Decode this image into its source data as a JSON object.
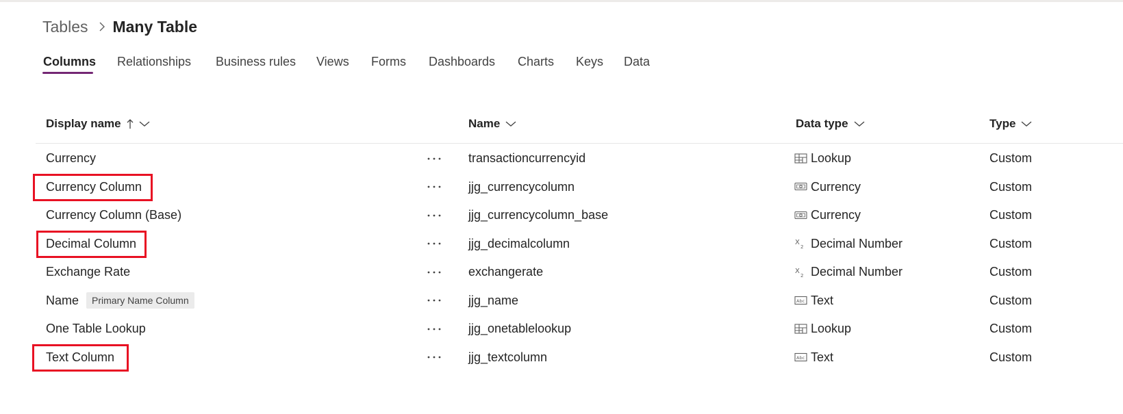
{
  "breadcrumb": {
    "root": "Tables",
    "current": "Many Table"
  },
  "tabs": [
    "Columns",
    "Relationships",
    "Business rules",
    "Views",
    "Forms",
    "Dashboards",
    "Charts",
    "Keys",
    "Data"
  ],
  "active_tab": "Columns",
  "columns": {
    "display_name": "Display name",
    "name": "Name",
    "data_type": "Data type",
    "type": "Type"
  },
  "sort": {
    "column": "Display name",
    "direction": "ascending"
  },
  "rows": [
    {
      "display": "Currency",
      "name": "transactioncurrencyid",
      "data_type": "Lookup",
      "icon": "lookup-icon",
      "type": "Custom"
    },
    {
      "display": "Currency Column",
      "name": "jjg_currencycolumn",
      "data_type": "Currency",
      "icon": "currency-icon",
      "type": "Custom",
      "highlighted": true
    },
    {
      "display": "Currency Column (Base)",
      "name": "jjg_currencycolumn_base",
      "data_type": "Currency",
      "icon": "currency-icon",
      "type": "Custom"
    },
    {
      "display": "Decimal Column",
      "name": "jjg_decimalcolumn",
      "data_type": "Decimal Number",
      "icon": "decimal-icon",
      "type": "Custom",
      "highlighted": true
    },
    {
      "display": "Exchange Rate",
      "name": "exchangerate",
      "data_type": "Decimal Number",
      "icon": "decimal-icon",
      "type": "Custom"
    },
    {
      "display": "Name",
      "badge": "Primary Name Column",
      "name": "jjg_name",
      "data_type": "Text",
      "icon": "text-icon",
      "type": "Custom"
    },
    {
      "display": "One Table Lookup",
      "name": "jjg_onetablelookup",
      "data_type": "Lookup",
      "icon": "lookup-icon",
      "type": "Custom"
    },
    {
      "display": "Text Column",
      "name": "jjg_textcolumn",
      "data_type": "Text",
      "icon": "text-icon",
      "type": "Custom",
      "highlighted": true
    }
  ],
  "colors": {
    "accent": "#742774",
    "highlight": "#e81123",
    "badge_bg": "#ebebeb"
  }
}
